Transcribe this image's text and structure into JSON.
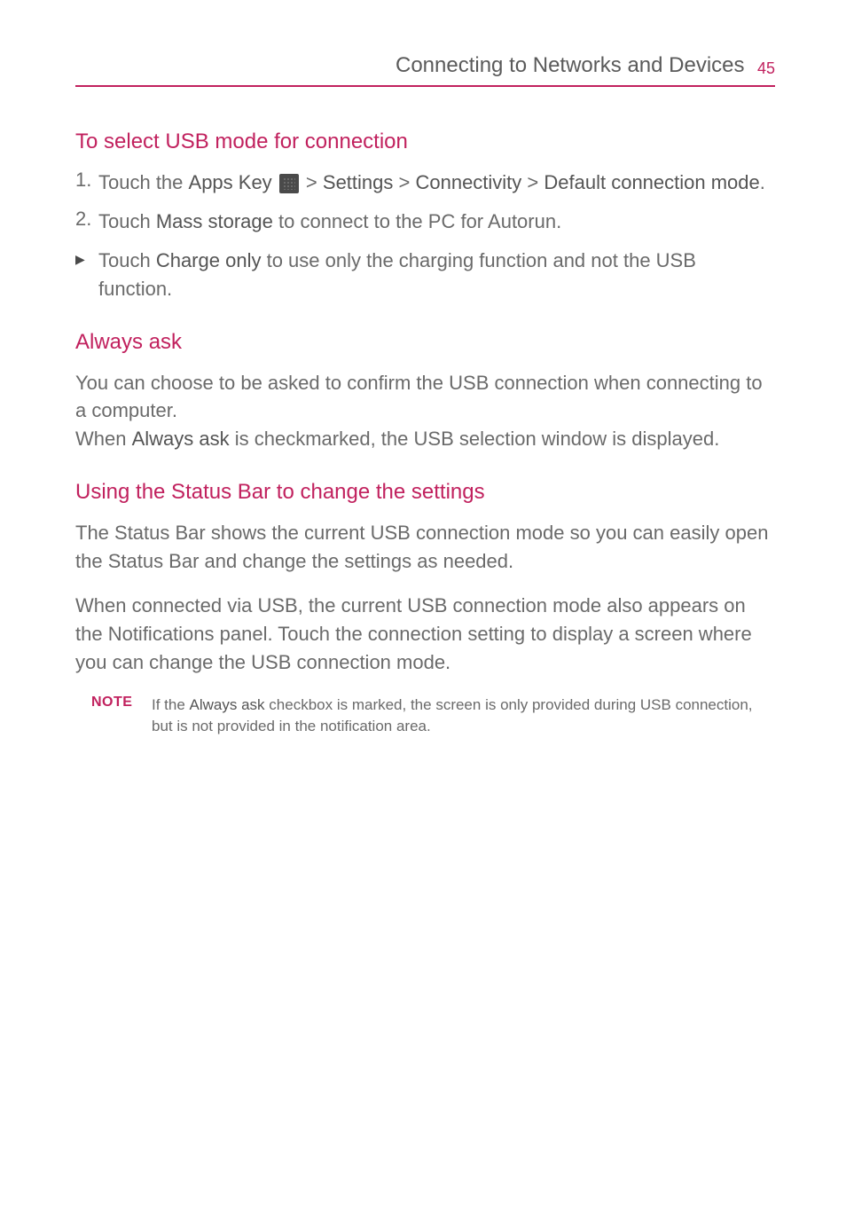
{
  "header": {
    "title": "Connecting to Networks and Devices",
    "page_number": "45"
  },
  "section1": {
    "heading": "To select USB mode for connection",
    "step1_num": "1.",
    "step1_a": "Touch the ",
    "step1_b": "Apps Key",
    "step1_c": " > ",
    "step1_d": "Settings",
    "step1_e": " > ",
    "step1_f": "Connectivity",
    "step1_g": " > ",
    "step1_h": "Default connection mode",
    "step1_i": ".",
    "step2_num": "2.",
    "step2_a": "Touch ",
    "step2_b": "Mass storage",
    "step2_c": " to connect to the PC for Autorun.",
    "bullet_a": "Touch ",
    "bullet_b": "Charge only",
    "bullet_c": " to use only the charging function and not the USB function."
  },
  "section2": {
    "heading": "Always ask",
    "p1": "You can choose to be asked to confirm the USB connection when connecting to a computer.",
    "p2_a": "When ",
    "p2_b": "Always ask",
    "p2_c": " is checkmarked, the USB selection window is displayed."
  },
  "section3": {
    "heading": "Using the Status Bar to change the settings",
    "p1": "The Status Bar shows the current USB connection mode so you can easily open the Status Bar and change the settings as needed.",
    "p2": "When connected via USB, the current USB connection mode also appears on the Notifications panel. Touch the connection setting to display a screen where you can change the USB connection mode."
  },
  "note": {
    "label": "NOTE",
    "text_a": "If the ",
    "text_b": "Always ask",
    "text_c": " checkbox is marked, the screen is only provided during USB connection, but is not provided in the notification area."
  }
}
